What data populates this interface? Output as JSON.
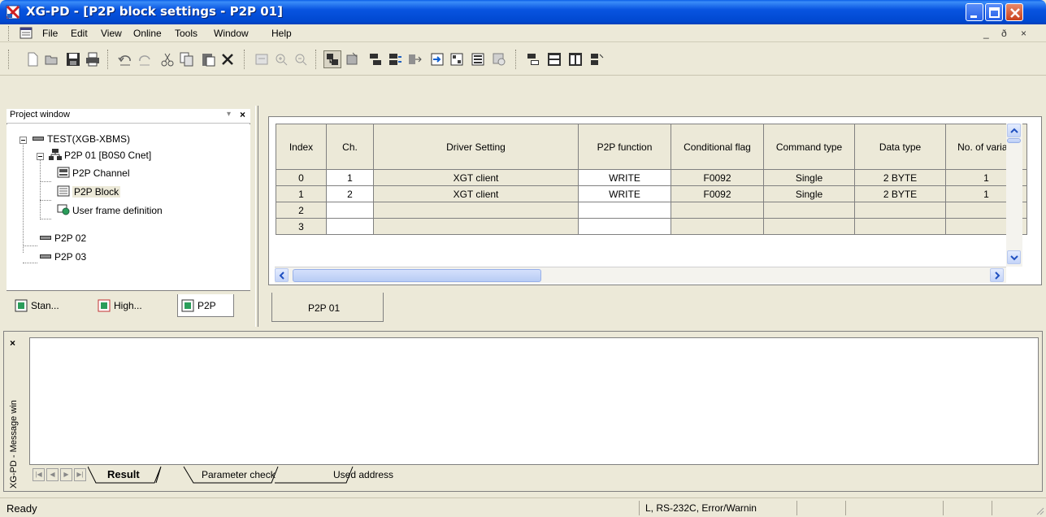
{
  "window": {
    "title": "XG-PD - [P2P block settings - P2P 01]"
  },
  "menubar": {
    "items": [
      "File",
      "Edit",
      "View",
      "Online",
      "Tools",
      "Window",
      "Help"
    ],
    "mdi_min": "_",
    "mdi_restore": "ð",
    "mdi_close": "×"
  },
  "toolbar": {
    "icons": [
      "new-icon",
      "open-icon",
      "save-icon",
      "print-icon",
      "undo-icon",
      "redo-icon",
      "cut-icon",
      "copy-icon",
      "paste-icon",
      "delete-icon",
      "connect-icon",
      "zoom-in-icon",
      "zoom-out-icon",
      "project-icon",
      "read-icon",
      "write-icon",
      "compare-icon",
      "export-icon",
      "import-icon",
      "monitor-icon",
      "diagnose-icon",
      "diagnose2-icon",
      "cascade-icon",
      "tile-h-icon",
      "tile-v-icon",
      "arrange-icon"
    ]
  },
  "project": {
    "header": "Project window",
    "pin": "▾",
    "close": "×",
    "tree": {
      "root": "TEST(XGB-XBMS)",
      "p2p01": "P2P 01 [B0S0 Cnet]",
      "channel": "P2P Channel",
      "block": "P2P Block",
      "userframe": "User frame definition",
      "p2p02": "P2P 02",
      "p2p03": "P2P 03"
    },
    "tabs": [
      "Stan...",
      "High...",
      "P2P"
    ]
  },
  "grid": {
    "headers": [
      "Index",
      "Ch.",
      "Driver Setting",
      "P2P function",
      "Conditional flag",
      "Command type",
      "Data type",
      "No. of variabl"
    ],
    "rows": [
      [
        "0",
        "1",
        "XGT client",
        "WRITE",
        "F0092",
        "Single",
        "2 BYTE",
        "1"
      ],
      [
        "1",
        "2",
        "XGT client",
        "WRITE",
        "F0092",
        "Single",
        "2 BYTE",
        "1"
      ],
      [
        "2",
        "",
        "",
        "",
        "",
        "",
        "",
        ""
      ],
      [
        "3",
        "",
        "",
        "",
        "",
        "",
        "",
        ""
      ]
    ],
    "sheet_tab": "P2P 01"
  },
  "message": {
    "close": "×",
    "vertical_title": "XG-PD - Message win",
    "tabs": [
      "Result",
      "Parameter check",
      "Used address"
    ]
  },
  "status": {
    "ready": "Ready",
    "connection": "L, RS-232C, Error/Warnin"
  }
}
